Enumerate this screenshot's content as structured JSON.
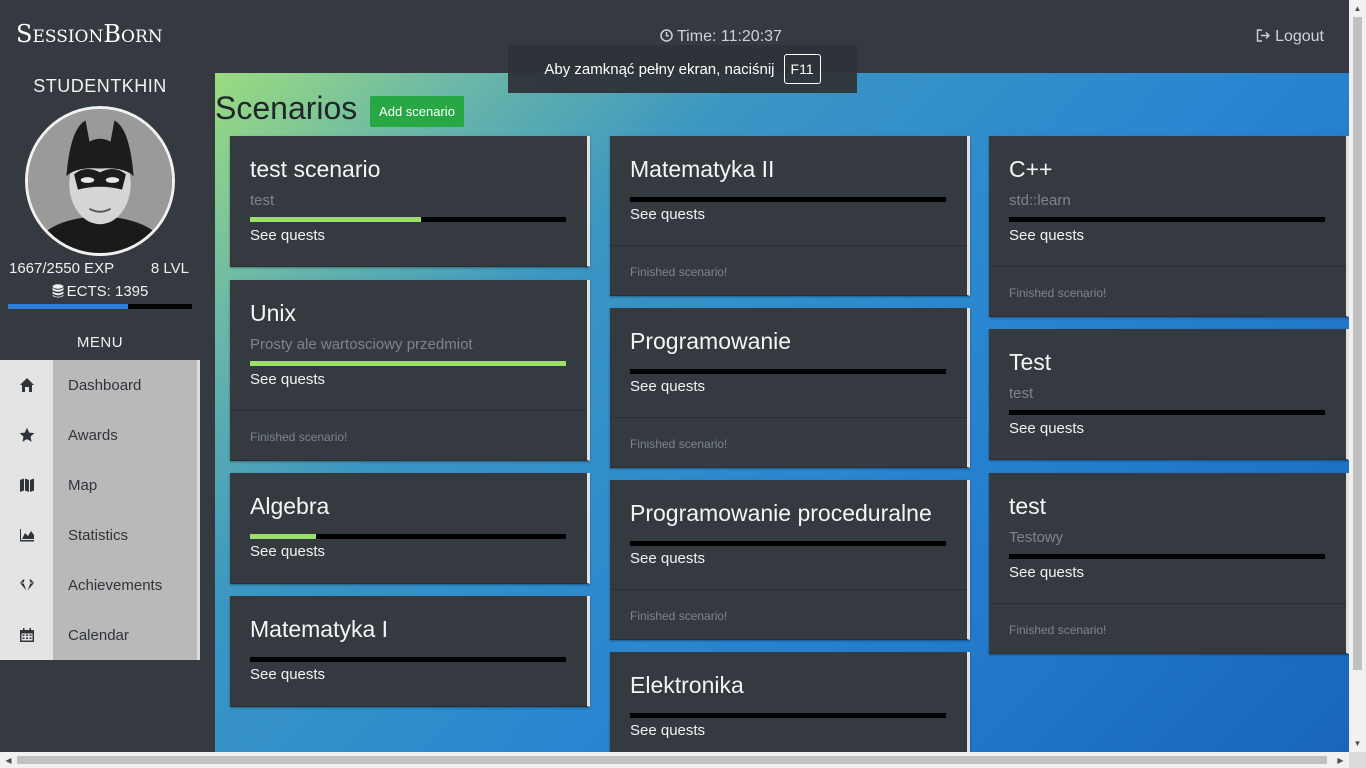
{
  "app": {
    "logo": "SessionBorn"
  },
  "user": {
    "username": "STUDENTKHIN",
    "exp_text": "1667/2550 EXP",
    "level_text": "8 LVL",
    "ects_text": "ECTS: 1395",
    "exp_progress": 0.6537
  },
  "menu": {
    "title": "MENU",
    "items": [
      {
        "label": "Dashboard",
        "icon": "home-icon"
      },
      {
        "label": "Awards",
        "icon": "star-icon"
      },
      {
        "label": "Map",
        "icon": "map-icon"
      },
      {
        "label": "Statistics",
        "icon": "area-chart-icon"
      },
      {
        "label": "Achievements",
        "icon": "diamond-icon"
      },
      {
        "label": "Calendar",
        "icon": "calendar-icon"
      }
    ]
  },
  "header": {
    "time_text": "Time: 11:20:37",
    "logout_label": "Logout"
  },
  "toast": {
    "message": "Aby zamknąć pełny ekran, naciśnij",
    "key": "F11"
  },
  "main": {
    "title": "Scenarios",
    "add_label": "Add scenario"
  },
  "quests_label": "See quests",
  "finished_label": "Finished scenario!",
  "columns": [
    [
      {
        "title": "test scenario",
        "subtitle": "test",
        "progress": 0.54,
        "finished": false
      },
      {
        "title": "Unix",
        "subtitle": "Prosty ale wartosciowy przedmiot",
        "progress": 1.0,
        "finished": true
      },
      {
        "title": "Algebra",
        "subtitle": "",
        "progress": 0.21,
        "finished": false
      },
      {
        "title": "Matematyka I",
        "subtitle": "",
        "progress": 0.0,
        "finished": false
      }
    ],
    [
      {
        "title": "Matematyka II",
        "subtitle": "",
        "progress": 0.0,
        "finished": true
      },
      {
        "title": "Programowanie",
        "subtitle": "",
        "progress": 0.0,
        "finished": true
      },
      {
        "title": "Programowanie proceduralne",
        "subtitle": "",
        "progress": 0.0,
        "finished": true
      },
      {
        "title": "Elektronika",
        "subtitle": "",
        "progress": 0.0,
        "finished": false
      }
    ],
    [
      {
        "title": "C++",
        "subtitle": "std::learn",
        "progress": 0.0,
        "finished": true
      },
      {
        "title": "Test",
        "subtitle": "test",
        "progress": 0.0,
        "finished": false
      },
      {
        "title": "test",
        "subtitle": "Testowy",
        "progress": 0.0,
        "finished": true
      }
    ]
  ],
  "colors": {
    "accent_green": "#28a745",
    "progress_green": "#9adf6a",
    "exp_blue": "#2b7fd8",
    "card_bg": "#353a41"
  }
}
